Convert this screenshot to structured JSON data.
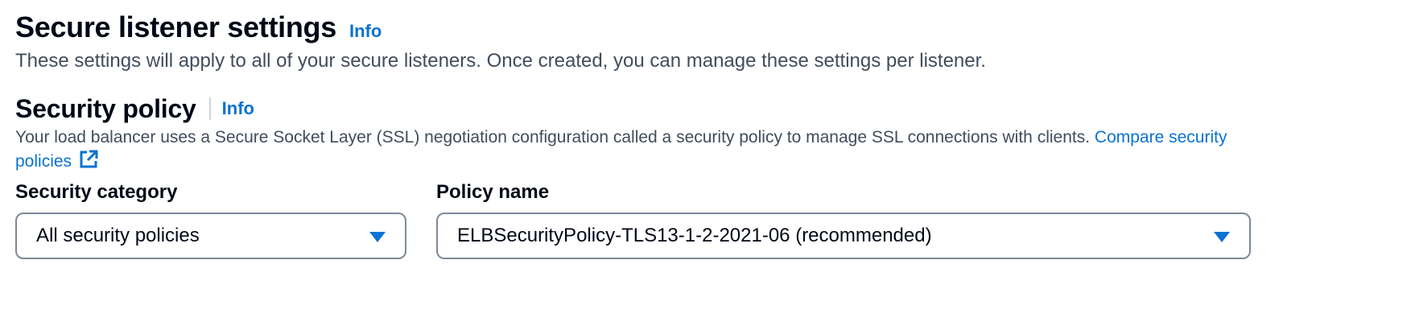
{
  "section": {
    "title": "Secure listener settings",
    "info_label": "Info",
    "description": "These settings will apply to all of your secure listeners. Once created, you can manage these settings per listener."
  },
  "security_policy": {
    "title": "Security policy",
    "info_label": "Info",
    "description": "Your load balancer uses a Secure Socket Layer (SSL) negotiation configuration called a security policy to manage SSL connections with clients.",
    "compare_link": "Compare security policies",
    "compare_link_icon": "external-link-icon"
  },
  "fields": {
    "category": {
      "label": "Security category",
      "selected": "All security policies"
    },
    "policy_name": {
      "label": "Policy name",
      "selected": "ELBSecurityPolicy-TLS13-1-2-2021-06 (recommended)"
    }
  },
  "colors": {
    "link": "#0972d3",
    "text": "#000716",
    "secondary_text": "#414d5c",
    "select_border": "#7d8998"
  }
}
